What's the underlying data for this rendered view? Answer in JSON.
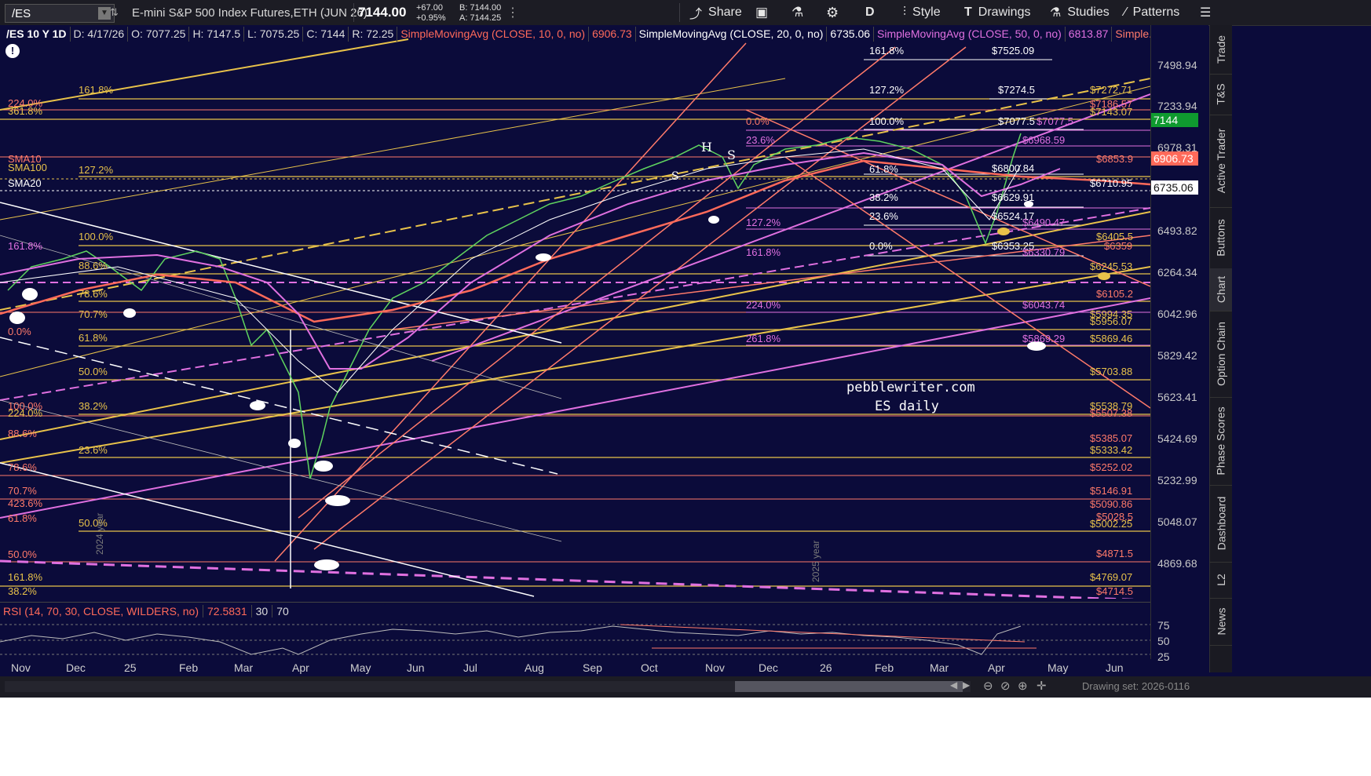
{
  "toolbar": {
    "symbol": "/ES",
    "description": "E-mini S&P 500 Index Futures,ETH (JUN 26)",
    "last_price": "7144.00",
    "change": "+67.00",
    "change_pct": "+0.95%",
    "bid": "B: 7144.00",
    "ask": "A: 7144.25",
    "share_label": "Share",
    "period_label": "D",
    "style_label": "Style",
    "drawings_label": "Drawings",
    "studies_label": "Studies",
    "patterns_label": "Patterns"
  },
  "legend": {
    "symbol": "/ES 10 Y 1D",
    "date": "D: 4/17/26",
    "open": "O: 7077.25",
    "high": "H: 7147.5",
    "low": "L: 7075.25",
    "close": "C: 7144",
    "range": "R: 72.25",
    "sma10": "SimpleMovingAvg (CLOSE, 10, 0, no)",
    "sma10_val": "6906.73",
    "sma20": "SimpleMovingAvg (CLOSE, 20, 0, no)",
    "sma20_val": "6735.06",
    "sma50": "SimpleMovingAvg (CLOSE, 50, 0, no)",
    "sma50_val": "6813.87",
    "more": "Simple..."
  },
  "price_axis": {
    "ticks": [
      "7498.94",
      "7233.94",
      "6978.31",
      "6735.06",
      "6493.82",
      "6264.34",
      "6042.96",
      "5829.42",
      "5623.41",
      "5424.69",
      "5232.99",
      "5048.07",
      "4869.68"
    ],
    "badge_last": "7144",
    "badge_sma10": "6906.73",
    "badge_sma20": "6735.06"
  },
  "level_labels": [
    "$7525.09",
    "$7274.5",
    "$7272.71",
    "$7186.57",
    "$7143.07",
    "$7077.5",
    "$7077.5",
    "$6968.59",
    "$6853.9",
    "$6800.84",
    "$6710.95",
    "$6629.91",
    "$6524.17",
    "$6490.47",
    "$6405.5",
    "$6359",
    "$6353.25",
    "$6330.79",
    "$6245.53",
    "$6105.2",
    "$6043.74",
    "$5994.35",
    "$5956.07",
    "$5869.29",
    "$5869.46",
    "$5703.88",
    "$5538.79",
    "$5507.38",
    "$5385.07",
    "$5333.42",
    "$5252.02",
    "$5146.91",
    "$5090.86",
    "$5028.5",
    "$5002.25",
    "$4871.5",
    "$4769.07",
    "$4714.5"
  ],
  "fib_labels": [
    "161.8%",
    "127.2%",
    "100.0%",
    "0.0%",
    "23.6%",
    "61.8%",
    "38.2%",
    "23.6%",
    "0.0%",
    "127.2%",
    "161.8%",
    "224.0%",
    "261.8%",
    "161.8%",
    "127.2%",
    "100.0%",
    "78.6%",
    "70.7%",
    "61.8%",
    "50.0%",
    "38.2%",
    "23.6%",
    "0.0%",
    "224.0%",
    "361.8%",
    "88.6%",
    "78.6%",
    "70.7%",
    "423.6%",
    "61.8%",
    "50.0%",
    "161.8%",
    "38.2%",
    "100.0%",
    "224.0%",
    "88.6%"
  ],
  "markers": {
    "sma10": "SMA10",
    "sma100": "SMA100",
    "sma20": "SMA20",
    "h": "H",
    "s1": "S",
    "s2": "S"
  },
  "watermark": {
    "line1": "pebblewriter.com",
    "line2": "ES daily"
  },
  "year_labels": [
    "2024 year",
    "2025 year"
  ],
  "rsi": {
    "label": "RSI (14, 70, 30, CLOSE, WILDERS, no)",
    "value": "72.5831",
    "upper": "30",
    "lower": "70",
    "axis": [
      "75",
      "50",
      "25"
    ]
  },
  "x_axis": [
    "Nov",
    "Dec",
    "25",
    "Feb",
    "Mar",
    "Apr",
    "May",
    "Jun",
    "Jul",
    "Aug",
    "Sep",
    "Oct",
    "Nov",
    "Dec",
    "26",
    "Feb",
    "Mar",
    "Apr",
    "May",
    "Jun"
  ],
  "sidebar_tabs": [
    "Trade",
    "T&S",
    "Active Trader",
    "Buttons",
    "Chart",
    "Option Chain",
    "Phase Scores",
    "Dashboard",
    "L2",
    "News"
  ],
  "status": {
    "drawing_set": "Drawing set: 2026-0116"
  },
  "colors": {
    "background": "#0b0b3a",
    "yellow": "#e8c24a",
    "salmon": "#ff7a6a",
    "magenta": "#e070e0",
    "white": "#ffffff",
    "sma_red": "#ff6a5a"
  }
}
